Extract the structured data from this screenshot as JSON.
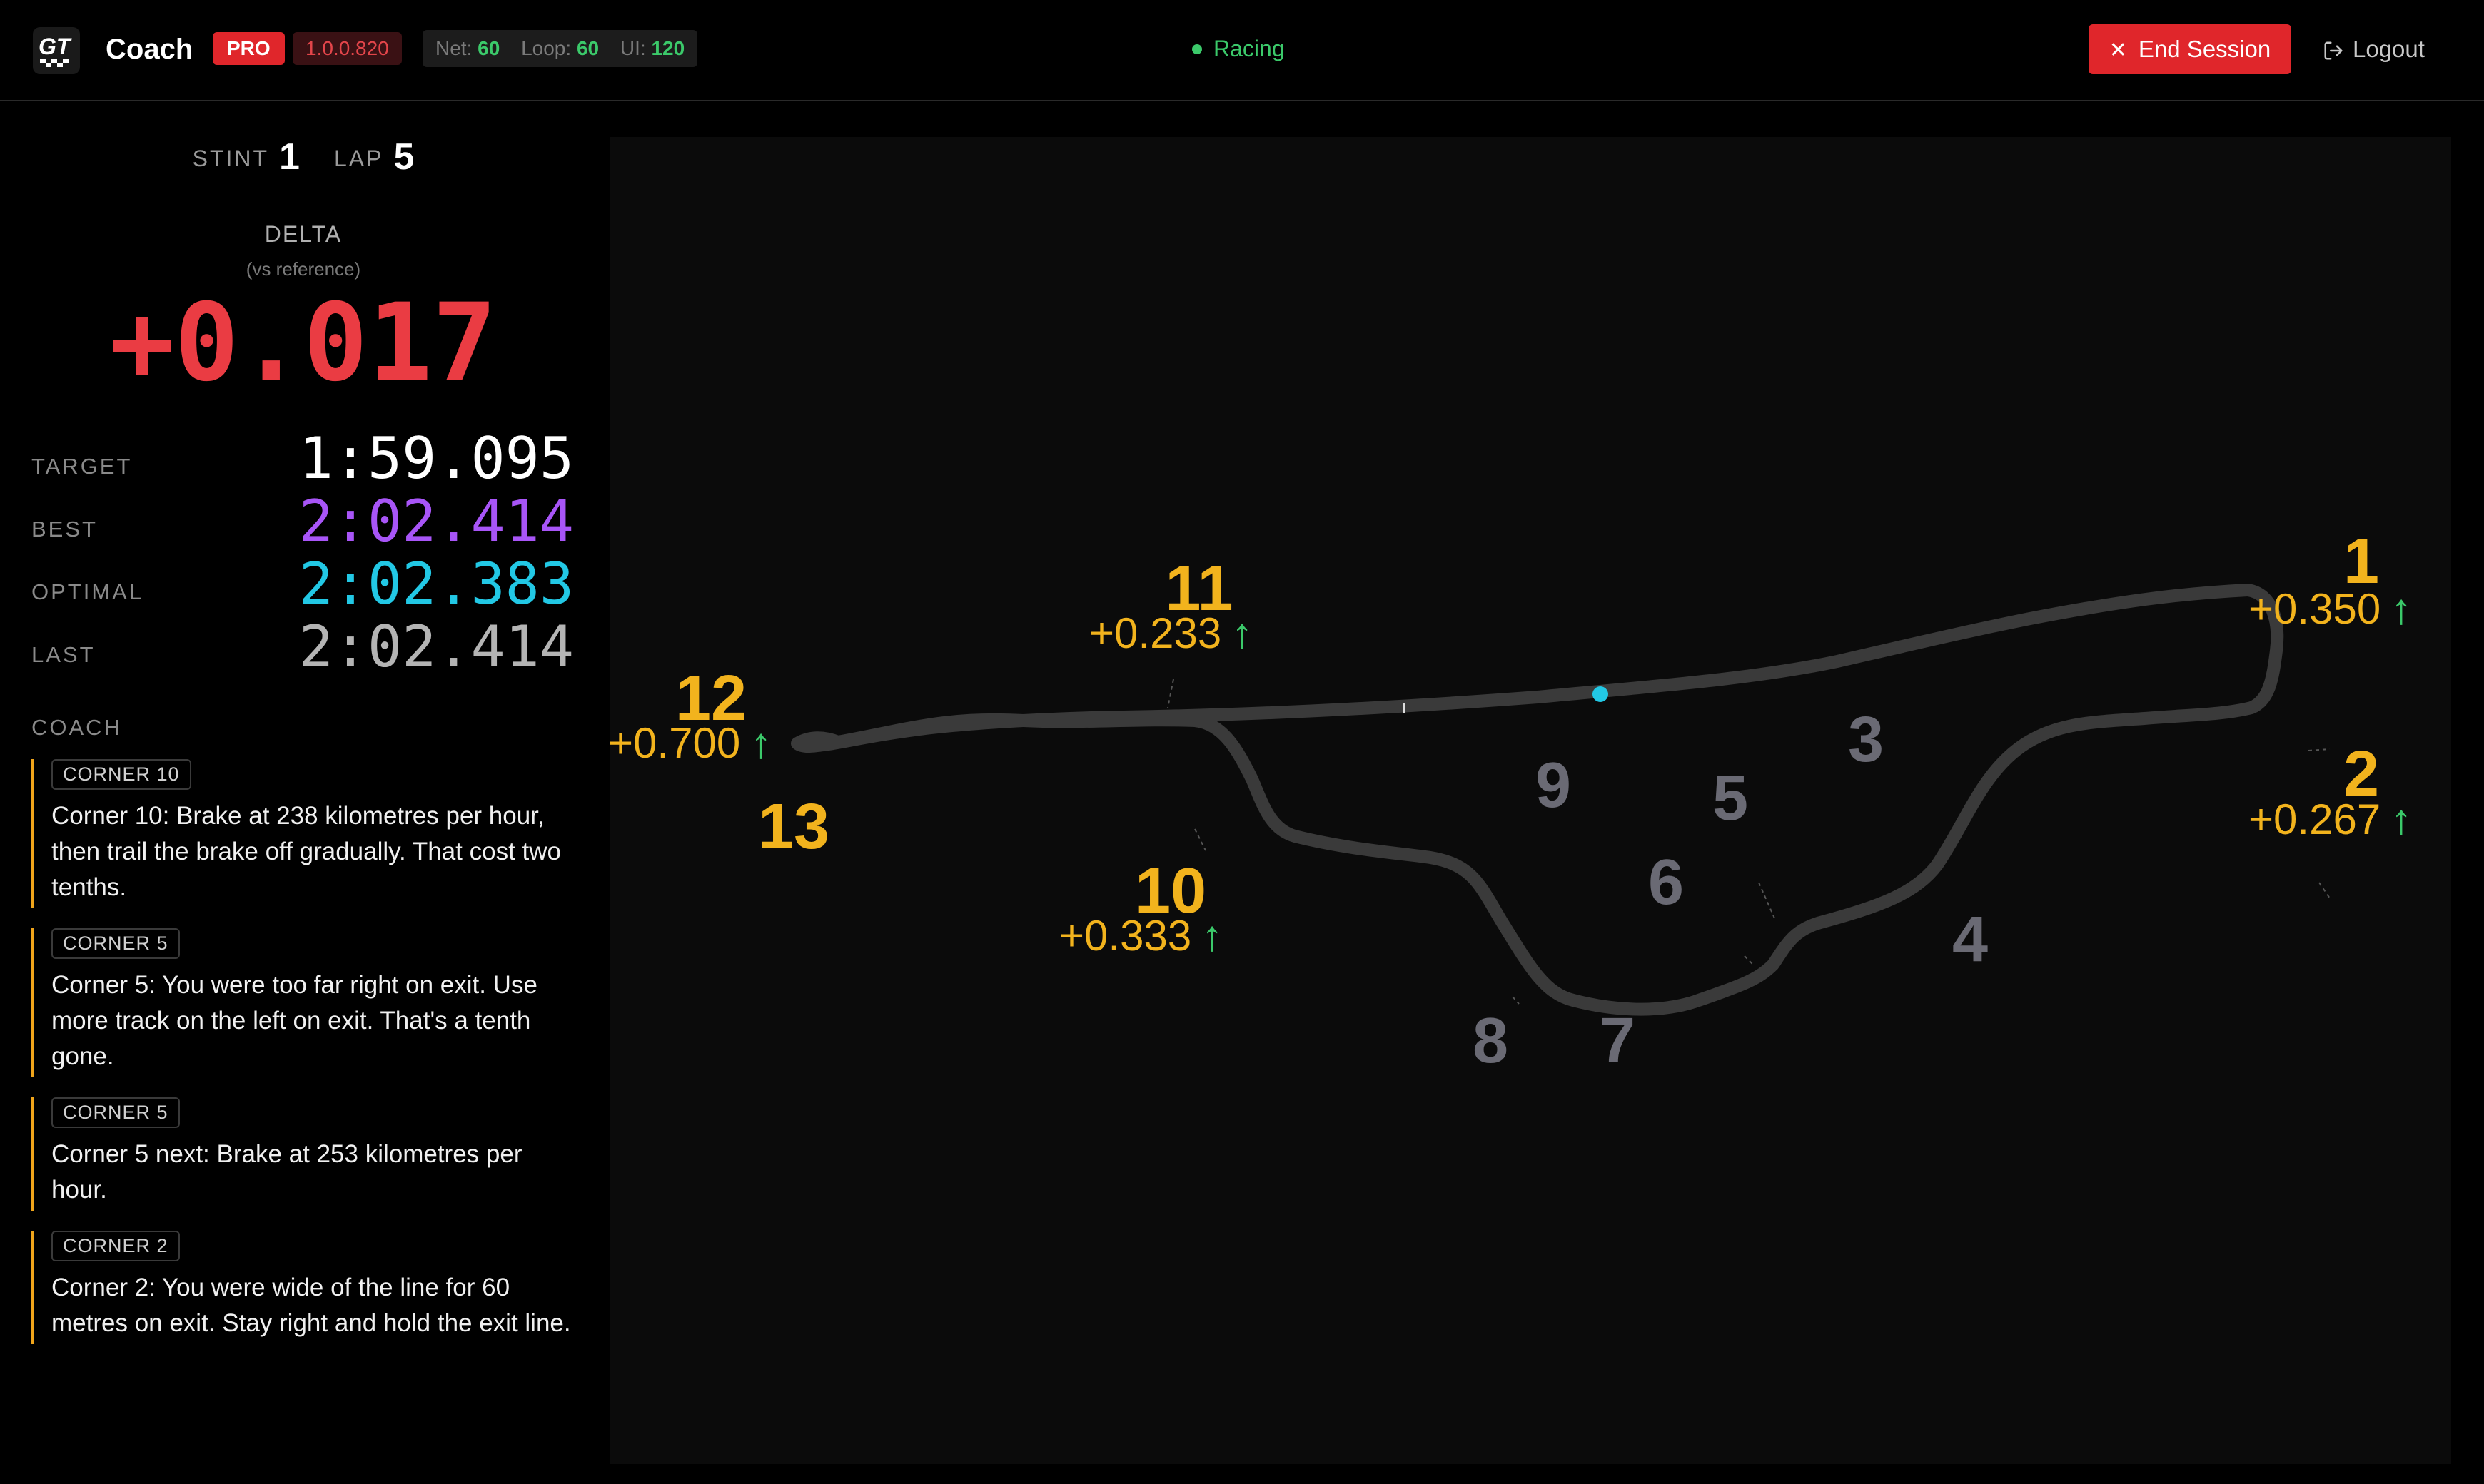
{
  "header": {
    "title": "Coach",
    "pro_label": "PRO",
    "version": "1.0.0.820",
    "stats": [
      {
        "label": "Net:",
        "value": "60"
      },
      {
        "label": "Loop:",
        "value": "60"
      },
      {
        "label": "UI:",
        "value": "120"
      }
    ],
    "status": "Racing",
    "end_session_label": "End Session",
    "logout_label": "Logout"
  },
  "session": {
    "stint_label": "STINT",
    "stint": "1",
    "lap_label": "LAP",
    "lap": "5"
  },
  "delta": {
    "label": "DELTA",
    "sublabel": "(vs reference)",
    "value": "+0.017",
    "color": "#ea3c43"
  },
  "times": [
    {
      "label": "TARGET",
      "value": "1:59.095",
      "color": "#ffffff"
    },
    {
      "label": "BEST",
      "value": "2:02.414",
      "color": "#a855f7"
    },
    {
      "label": "OPTIMAL",
      "value": "2:02.383",
      "color": "#22c8e5"
    },
    {
      "label": "LAST",
      "value": "2:02.414",
      "color": "#b4b4b4"
    }
  ],
  "coach": {
    "heading": "COACH",
    "messages": [
      {
        "tag": "CORNER 10",
        "text": "Corner 10: Brake at 238 kilometres per hour, then trail the brake off gradually. That cost two tenths."
      },
      {
        "tag": "CORNER 5",
        "text": "Corner 5: You were too far right on exit. Use more track on the left on exit. That's a tenth gone."
      },
      {
        "tag": "CORNER 5",
        "text": "Corner 5 next: Brake at 253 kilometres per hour."
      },
      {
        "tag": "CORNER 2",
        "text": "Corner 2: You were wide of the line for 60 metres on exit. Stay right and hold the exit line."
      }
    ]
  },
  "track_map": {
    "corners_highlighted": [
      {
        "num": "1",
        "delta": "+0.350"
      },
      {
        "num": "2",
        "delta": "+0.267"
      },
      {
        "num": "10",
        "delta": "+0.333"
      },
      {
        "num": "11",
        "delta": "+0.233"
      },
      {
        "num": "12",
        "delta": "+0.700"
      },
      {
        "num": "13"
      }
    ],
    "corners_plain": [
      "3",
      "4",
      "5",
      "6",
      "7",
      "8",
      "9"
    ],
    "improvement_arrow": "↑",
    "colors": {
      "highlight": "#f2b31d",
      "plain": "#6a6a74",
      "track": "#3a3a3a",
      "car": "#22c8e5",
      "improve": "#3bc96a"
    }
  },
  "icons": {
    "logo": "gt-logo-icon",
    "close": "close-icon",
    "logout": "logout-icon",
    "status": "status-dot-icon",
    "car": "car-position-icon",
    "arrow": "arrow-up-icon"
  }
}
